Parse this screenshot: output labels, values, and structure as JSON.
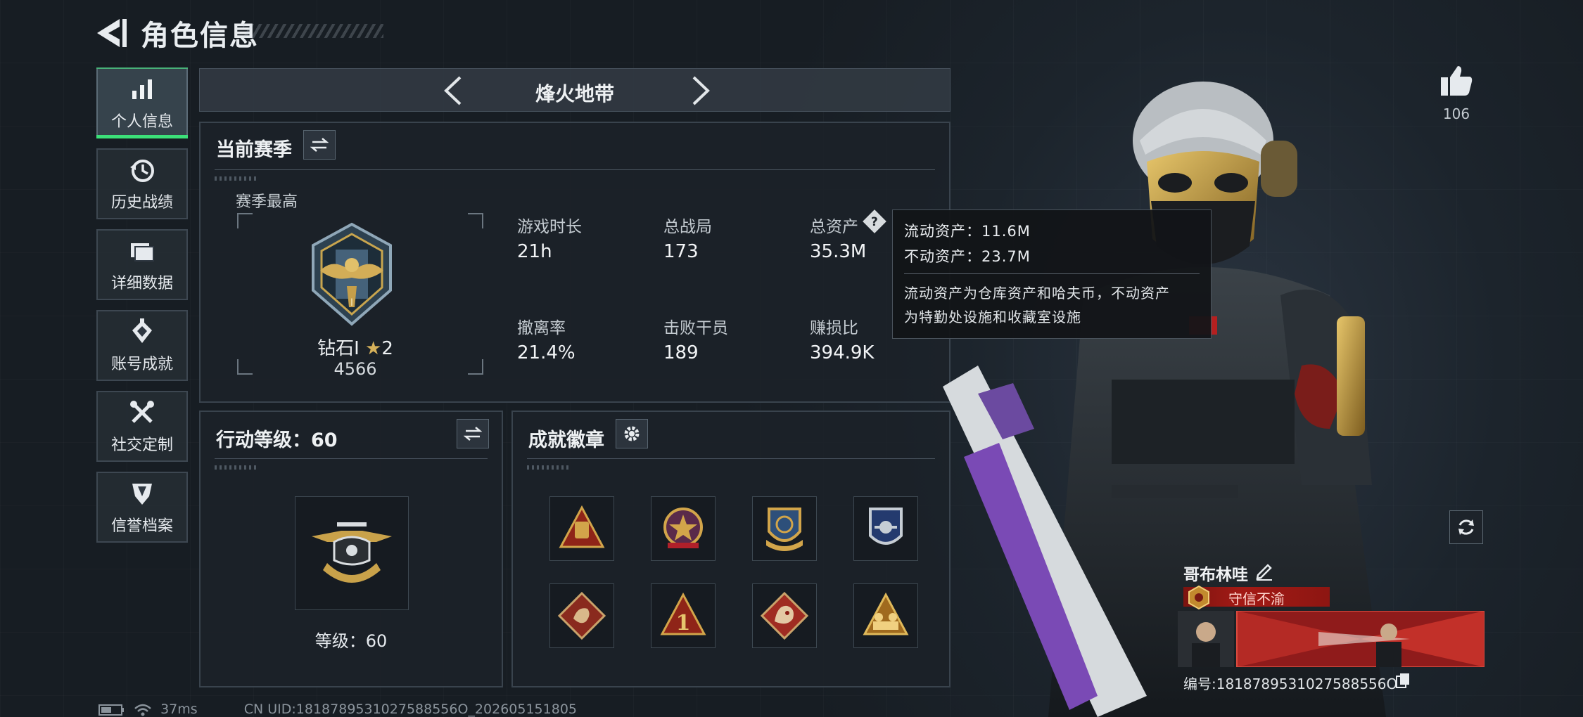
{
  "header": {
    "title": "角色信息",
    "back_icon": "back-arrow-icon"
  },
  "sidebar": {
    "items": [
      {
        "label": "个人信息",
        "icon": "bar-chart-icon",
        "active": true
      },
      {
        "label": "历史战绩",
        "icon": "history-clock-icon",
        "active": false
      },
      {
        "label": "详细数据",
        "icon": "folder-icon",
        "active": false
      },
      {
        "label": "账号成就",
        "icon": "achievement-icon",
        "active": false
      },
      {
        "label": "社交定制",
        "icon": "tools-icon",
        "active": false
      },
      {
        "label": "信誉档案",
        "icon": "shield-icon",
        "active": false
      }
    ]
  },
  "mode": {
    "title": "烽火地带"
  },
  "season": {
    "title": "当前赛季",
    "best_label": "赛季最高",
    "rank_name": "钻石Ⅰ",
    "rank_stars": "2",
    "rank_score": "4566",
    "stats": [
      {
        "label": "游戏时长",
        "value": "21h"
      },
      {
        "label": "总战局",
        "value": "173"
      },
      {
        "label": "总资产",
        "value": "35.3M"
      },
      {
        "label": "撤离率",
        "value": "21.4%"
      },
      {
        "label": "击败干员",
        "value": "189"
      },
      {
        "label": "赚损比",
        "value": "394.9K"
      }
    ]
  },
  "tooltip": {
    "liquid": "流动资产：11.6M",
    "fixed": "不动资产：23.7M",
    "desc_line1": "流动资产为仓库资产和哈夫币，不动资产",
    "desc_line2": "为特勤处设施和收藏室设施"
  },
  "level": {
    "title": "行动等级：60",
    "caption": "等级：60"
  },
  "badges": {
    "title": "成就徽章",
    "items": [
      {
        "icon": "triangle-pack-badge-icon"
      },
      {
        "icon": "star-badge-icon"
      },
      {
        "icon": "shield-badge-icon"
      },
      {
        "icon": "blue-shield-badge-icon"
      },
      {
        "icon": "dragon-diamond-badge-icon"
      },
      {
        "icon": "number-one-badge-icon"
      },
      {
        "icon": "beast-diamond-badge-icon"
      },
      {
        "icon": "squad-badge-icon"
      }
    ]
  },
  "profile": {
    "likes": "106",
    "name": "哥布林哇",
    "title_plate": "守信不渝",
    "id_text": "编号:1818789531027588556O"
  },
  "status_bar": {
    "ping": "37ms",
    "uid": "CN UID:1818789531027588556O_202605151805"
  },
  "colors": {
    "accent_green": "#3ce079",
    "gold": "#c9a24a",
    "panel_border": "#39434d",
    "title_red": "#a31a15"
  }
}
